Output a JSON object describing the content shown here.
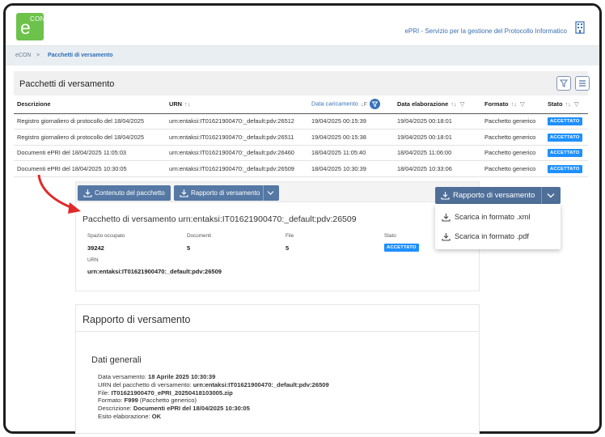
{
  "header": {
    "logo_main": "e",
    "logo_super": "CON",
    "app_title": "ePRI - Servizio per la gestione del Protocollo Informatico"
  },
  "breadcrumb": {
    "home": "eCON",
    "separator": ">",
    "current": "Pacchetti di versamento"
  },
  "panel": {
    "title": "Pacchetti di versamento",
    "columns": [
      {
        "label": "Descrizione"
      },
      {
        "label": "URN",
        "sort": "↑↓"
      },
      {
        "label": "Data caricamento",
        "sort": "↓F"
      },
      {
        "label": "Data elaborazione",
        "sort": "↑↓"
      },
      {
        "label": "Formato",
        "sort": "↑↓"
      },
      {
        "label": "Stato",
        "sort": "↑↓"
      }
    ],
    "rows": [
      {
        "descrizione": "Registro giornaliero di protocollo del 18/04/2025",
        "urn": "urn:entaksi:IT01621900470:_default:pdv:26512",
        "data_caricamento": "19/04/2025 00:15:39",
        "data_elaborazione": "19/04/2025 00:18:01",
        "formato": "Pacchetto generico",
        "stato": "ACCETTATO"
      },
      {
        "descrizione": "Registro giornaliero di protocollo del 18/04/2025",
        "urn": "urn:entaksi:IT01621900470:_default:pdv:26511",
        "data_caricamento": "19/04/2025 00:15:38",
        "data_elaborazione": "19/04/2025 00:18:01",
        "formato": "Pacchetto generico",
        "stato": "ACCETTATO"
      },
      {
        "descrizione": "Documenti ePRI del 18/04/2025 11:05:03",
        "urn": "urn:entaksi:IT01621900470:_default:pdv:26460",
        "data_caricamento": "18/04/2025 11:05:40",
        "data_elaborazione": "18/04/2025 11:06:00",
        "formato": "Pacchetto generico",
        "stato": "ACCETTATO"
      },
      {
        "descrizione": "Documenti ePRI del 18/04/2025 10:30:05",
        "urn": "urn:entaksi:IT01621900470:_default:pdv:26509",
        "data_caricamento": "18/04/2025 10:30:39",
        "data_elaborazione": "18/04/2025 10:33:06",
        "formato": "Pacchetto generico",
        "stato": "ACCETTATO"
      }
    ]
  },
  "detail": {
    "btn_contenuto": "Contenuto del pacchetto",
    "btn_rapporto": "Rapporto di versamento",
    "title": "Pacchetto di versamento urn:entaksi:IT01621900470:_default:pdv:26509",
    "spazio_label": "Spazio occupato",
    "spazio_value": "39242",
    "documenti_label": "Documenti",
    "documenti_value": "5",
    "file_label": "File",
    "file_value": "5",
    "stato_label": "Stato",
    "stato_value": "ACCETTATO",
    "urn_label": "URN",
    "urn_value": "urn:entaksi:IT01621900470:_default:pdv:26509"
  },
  "dropdown": {
    "button": "Rapporto di versamento",
    "items": [
      "Scarica in formato .xml",
      "Scarica in formato .pdf"
    ]
  },
  "report": {
    "title": "Rapporto di versamento",
    "section": "Dati generali",
    "rows": [
      {
        "label": "Data versamento: ",
        "value": "18 Aprile 2025 10:30:39",
        "extra": ""
      },
      {
        "label": "URN del pacchetto di versamento: ",
        "value": "urn:entaksi:IT01621900470:_default:pdv:26509",
        "extra": ""
      },
      {
        "label": "File: ",
        "value": "IT01621900470_ePRI_20250418103005.zip",
        "extra": ""
      },
      {
        "label": "Formato: ",
        "value": "F999",
        "extra": " (Pacchetto generico)"
      },
      {
        "label": "Descrizione: ",
        "value": "Documenti ePRI del 18/04/2025 10:30:05",
        "extra": ""
      },
      {
        "label": "Esito elaborazione: ",
        "value": "OK",
        "extra": ""
      }
    ]
  },
  "colors": {
    "accent": "#3a72b8",
    "badge": "#1e90ff",
    "button": "#5578a4",
    "logo": "#6cc24a",
    "arrow": "#e02a2a"
  }
}
